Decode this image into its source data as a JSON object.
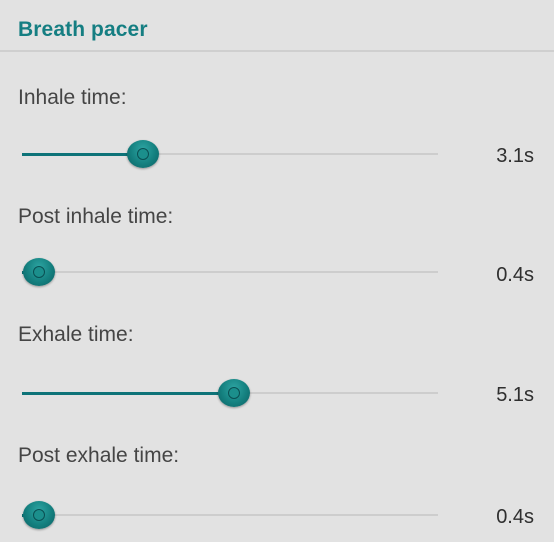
{
  "header": {
    "title": "Breath pacer"
  },
  "accent_color": "#157e82",
  "sliders": [
    {
      "label": "Inhale time:",
      "value_text": "3.1s",
      "level": 0.29
    },
    {
      "label": "Post inhale time:",
      "value_text": "0.4s",
      "level": 0.04
    },
    {
      "label": "Exhale time:",
      "value_text": "5.1s",
      "level": 0.51
    },
    {
      "label": "Post exhale time:",
      "value_text": "0.4s",
      "level": 0.04
    }
  ]
}
